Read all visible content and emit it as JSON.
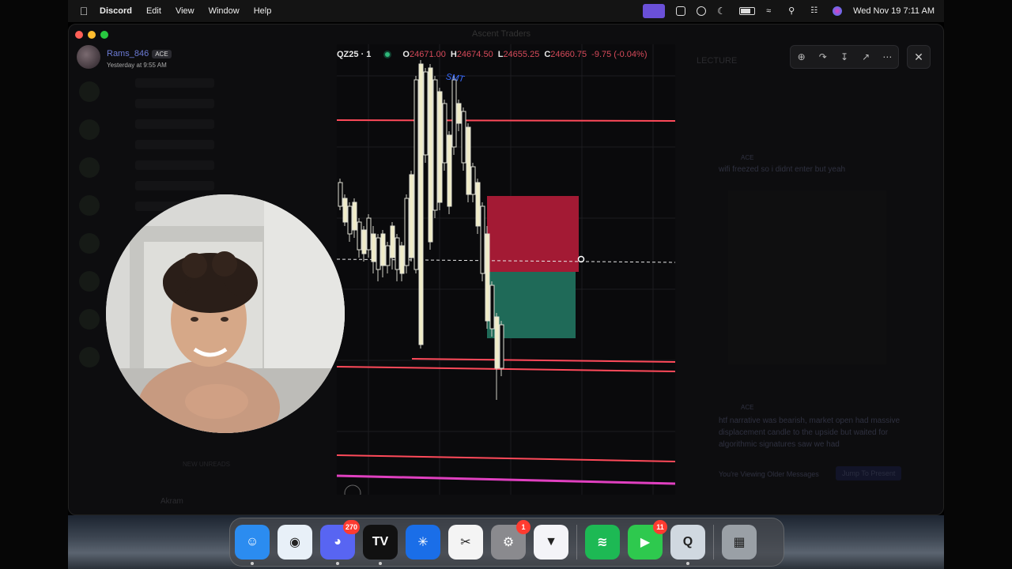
{
  "menubar": {
    "app_name": "Discord",
    "items": [
      "Edit",
      "View",
      "Window",
      "Help"
    ],
    "clock": "Wed Nov 19  7:11 AM"
  },
  "window": {
    "title": "Ascent Traders",
    "user": {
      "name": "Rams_846",
      "badge": "ACE",
      "timestamp": "Yesterday at 9:55 AM"
    },
    "right_channel": "LECTURE",
    "right_messages": [
      {
        "author": "ACE",
        "text": "wifi freezed so i didnt enter but yeah"
      },
      {
        "author": "ACE",
        "text": "htf narrative was bearish, market open had massive displacement candle to the upside but waited for algorithmic signatures saw we had"
      }
    ],
    "older_messages_text": "You're Viewing Older Messages",
    "jump_button": "Jump To Present",
    "new_unreads": "NEW UNREADS",
    "footer_user": "Akram"
  },
  "chart": {
    "symbol": "QZ25 · 1",
    "open_label": "O",
    "open": "24671.00",
    "high_label": "H",
    "high": "24674.50",
    "low_label": "L",
    "low": "24655.25",
    "close_label": "C",
    "close": "24660.75",
    "change": "-9.75 (-0.04%)",
    "annotation": "SMT",
    "colors": {
      "bull_candle": "#f0ecc8",
      "bear_candle": "#d8d8d0",
      "line_red": "#ff4a5a",
      "line_magenta": "#e040c0",
      "zone_red": "#a31a34",
      "zone_green": "#1f6a58"
    }
  },
  "toolbar": {
    "icons": [
      "zoom-icon",
      "forward-icon",
      "download-icon",
      "open-external-icon",
      "more-icon"
    ],
    "close_icon": "close-icon"
  },
  "dock": {
    "apps": [
      {
        "name": "Finder",
        "icon": "finder-icon",
        "badge": "",
        "running": true,
        "color": "#2b8cf0"
      },
      {
        "name": "Safari",
        "icon": "safari-icon",
        "badge": "",
        "running": false,
        "color": "#e8f0f8"
      },
      {
        "name": "Discord",
        "icon": "discord-icon",
        "badge": "270",
        "running": true,
        "color": "#5865f2"
      },
      {
        "name": "TradingView",
        "icon": "tradingview-icon",
        "badge": "",
        "running": true,
        "color": "#111111"
      },
      {
        "name": "Perplexity",
        "icon": "asterisk-icon",
        "badge": "",
        "running": false,
        "color": "#1a6ee8"
      },
      {
        "name": "CapCut",
        "icon": "capcut-icon",
        "badge": "",
        "running": false,
        "color": "#f4f4f4"
      },
      {
        "name": "System Settings",
        "icon": "settings-icon",
        "badge": "1",
        "running": false,
        "color": "#8a8a8e"
      },
      {
        "name": "Proton VPN",
        "icon": "vpn-icon",
        "badge": "",
        "running": false,
        "color": "#f4f4f8"
      },
      {
        "name": "Spotify",
        "icon": "spotify-icon",
        "badge": "",
        "running": false,
        "color": "#1db954"
      },
      {
        "name": "FaceTime",
        "icon": "facetime-icon",
        "badge": "11",
        "running": false,
        "color": "#2ec94e"
      },
      {
        "name": "QuickTime",
        "icon": "quicktime-icon",
        "badge": "",
        "running": true,
        "color": "#d0d8e0"
      },
      {
        "name": "Trash",
        "icon": "trash-icon",
        "badge": "",
        "running": false,
        "color": "#9aa0a6"
      }
    ]
  }
}
